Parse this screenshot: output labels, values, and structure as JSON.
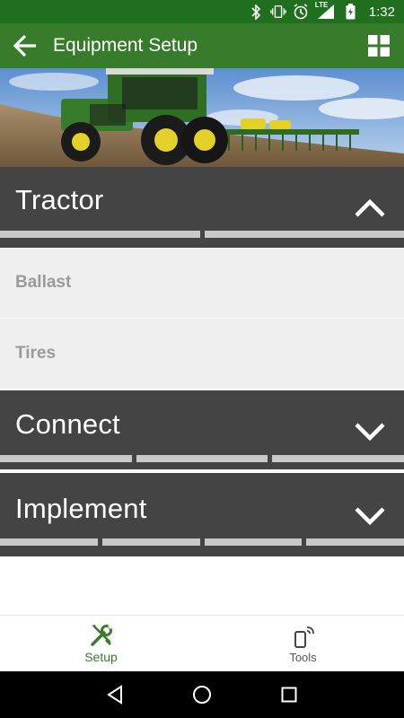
{
  "status_bar": {
    "time": "1:32",
    "network_label": "LTE",
    "icons": [
      "bluetooth-icon",
      "vibrate-icon",
      "alarm-icon",
      "lte-signal-icon",
      "battery-icon"
    ]
  },
  "app_bar": {
    "title": "Equipment Setup",
    "back_icon": "arrow-left-icon",
    "menu_icon": "grid-icon"
  },
  "hero": {
    "alt": "tractor-hero-image"
  },
  "sections": [
    {
      "title": "Tractor",
      "expanded": true,
      "progress_segments": 2,
      "items": [
        "Ballast",
        "Tires"
      ]
    },
    {
      "title": "Connect",
      "expanded": false,
      "progress_segments": 3,
      "items": []
    },
    {
      "title": "Implement",
      "expanded": false,
      "progress_segments": 4,
      "items": []
    }
  ],
  "bottom_nav": [
    {
      "label": "Setup",
      "icon": "wrench-screwdriver-icon",
      "active": true
    },
    {
      "label": "Tools",
      "icon": "phone-wireless-icon",
      "active": false
    }
  ],
  "colors": {
    "accent": "#367c2b",
    "status_bar": "#1f6f1f",
    "section_header": "#444444",
    "sub_item_bg": "#efefef",
    "sub_item_text": "#9a9a9a",
    "progress_segment": "#c9c9c9"
  }
}
